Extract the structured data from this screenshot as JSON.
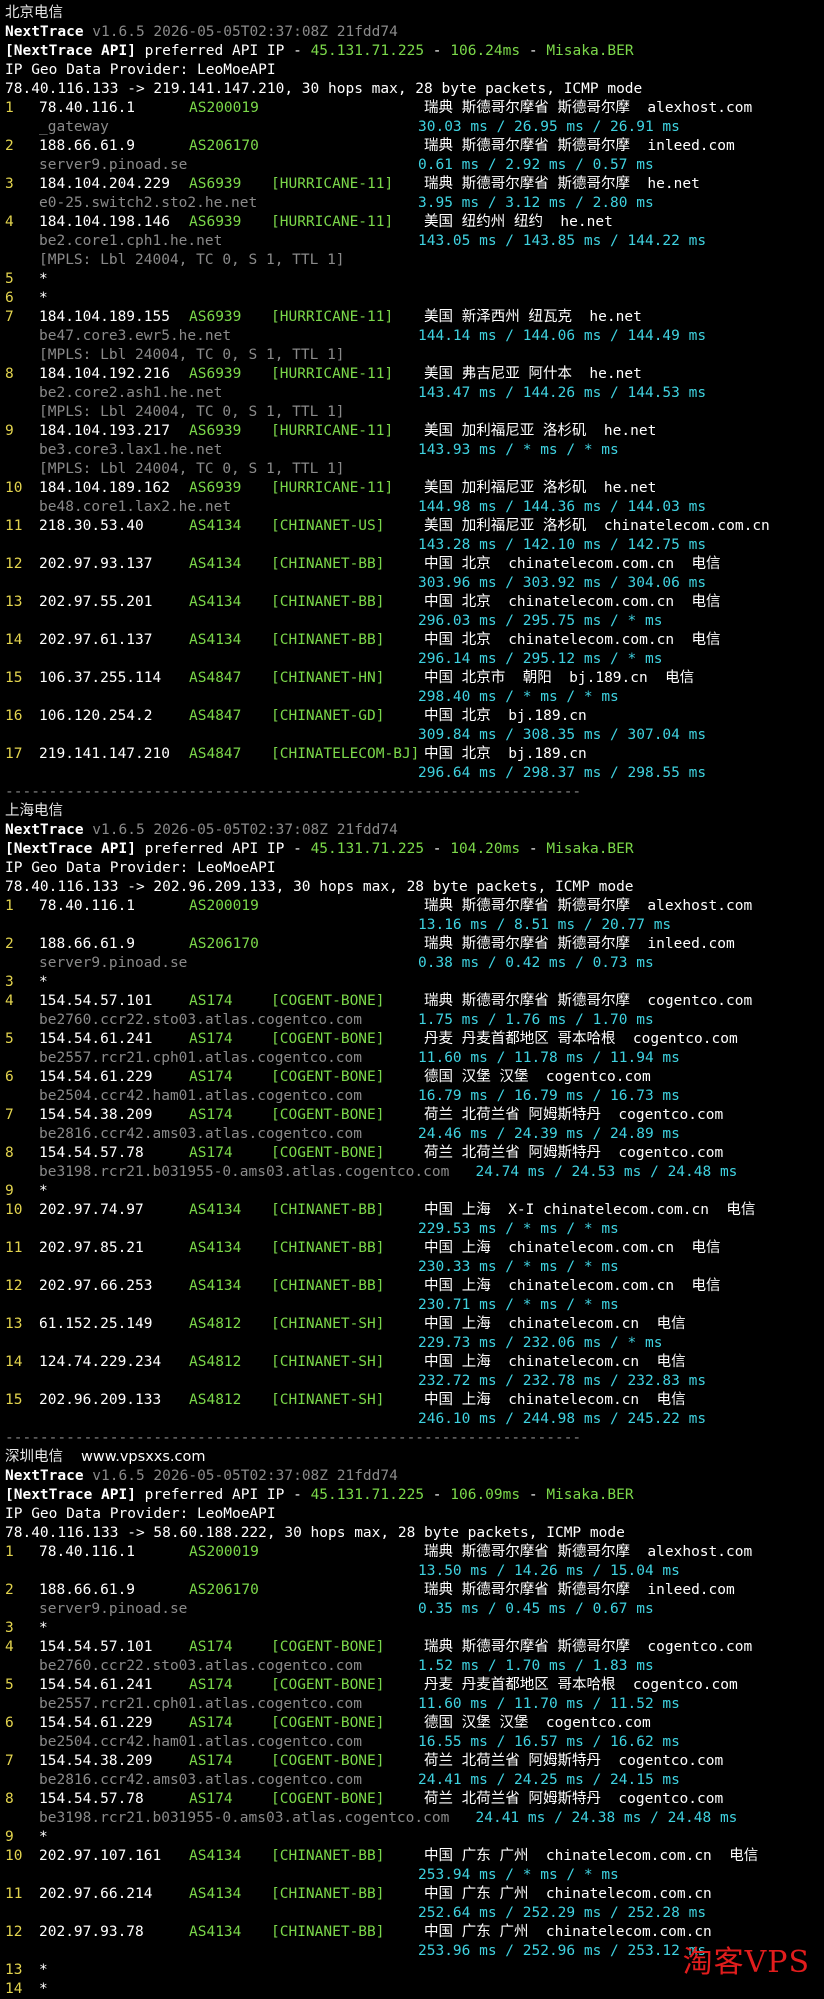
{
  "sections": [
    {
      "title": "北京电信",
      "site": "",
      "header": {
        "app_name": "NextTrace",
        "version": " v1.6.5 2026-05-05T02:37:08Z 21fdd74",
        "api_prefix": "[NextTrace API]",
        "api_text": " preferred API IP - ",
        "api_ip": "45.131.71.225",
        "api_ms": "106.24ms",
        "api_node": "Misaka.BER",
        "geo_provider": "IP Geo Data Provider: LeoMoeAPI",
        "trace_line": "78.40.116.133 -> 219.141.147.210, 30 hops max, 28 byte packets, ICMP mode"
      },
      "hops": [
        {
          "hop": "1",
          "ip": "78.40.116.1",
          "asn": "AS200019",
          "tag": "",
          "geo": "瑞典 斯德哥尔摩省 斯德哥尔摩  alexhost.com",
          "times": "30.03 ms / 26.95 ms / 26.91 ms",
          "host": "_gateway",
          "extra": ""
        },
        {
          "hop": "2",
          "ip": "188.66.61.9",
          "asn": "AS206170",
          "tag": "",
          "geo": "瑞典 斯德哥尔摩省 斯德哥尔摩  inleed.com",
          "times": "0.61 ms / 2.92 ms / 0.57 ms",
          "host": "server9.pinoad.se",
          "extra": ""
        },
        {
          "hop": "3",
          "ip": "184.104.204.229",
          "asn": "AS6939",
          "tag": "[HURRICANE-11]",
          "geo": "瑞典 斯德哥尔摩省 斯德哥尔摩  he.net",
          "times": "3.95 ms / 3.12 ms / 2.80 ms",
          "host": "e0-25.switch2.sto2.he.net",
          "extra": ""
        },
        {
          "hop": "4",
          "ip": "184.104.198.146",
          "asn": "AS6939",
          "tag": "[HURRICANE-11]",
          "geo": "美国 纽约州 纽约  he.net",
          "times": "143.05 ms / 143.85 ms / 144.22 ms",
          "host": "be2.core1.cph1.he.net",
          "extra": "[MPLS: Lbl 24004, TC 0, S 1, TTL 1]"
        },
        {
          "hop": "5",
          "ip": "*",
          "asn": "",
          "tag": "",
          "geo": "",
          "times": "",
          "host": "",
          "extra": ""
        },
        {
          "hop": "6",
          "ip": "*",
          "asn": "",
          "tag": "",
          "geo": "",
          "times": "",
          "host": "",
          "extra": ""
        },
        {
          "hop": "7",
          "ip": "184.104.189.155",
          "asn": "AS6939",
          "tag": "[HURRICANE-11]",
          "geo": "美国 新泽西州 纽瓦克  he.net",
          "times": "144.14 ms / 144.06 ms / 144.49 ms",
          "host": "be47.core3.ewr5.he.net",
          "extra": "[MPLS: Lbl 24004, TC 0, S 1, TTL 1]"
        },
        {
          "hop": "8",
          "ip": "184.104.192.216",
          "asn": "AS6939",
          "tag": "[HURRICANE-11]",
          "geo": "美国 弗吉尼亚 阿什本  he.net",
          "times": "143.47 ms / 144.26 ms / 144.53 ms",
          "host": "be2.core2.ash1.he.net",
          "extra": "[MPLS: Lbl 24004, TC 0, S 1, TTL 1]"
        },
        {
          "hop": "9",
          "ip": "184.104.193.217",
          "asn": "AS6939",
          "tag": "[HURRICANE-11]",
          "geo": "美国 加利福尼亚 洛杉矶  he.net",
          "times": "143.93 ms / * ms / * ms",
          "host": "be3.core3.lax1.he.net",
          "extra": "[MPLS: Lbl 24004, TC 0, S 1, TTL 1]"
        },
        {
          "hop": "10",
          "ip": "184.104.189.162",
          "asn": "AS6939",
          "tag": "[HURRICANE-11]",
          "geo": "美国 加利福尼亚 洛杉矶  he.net",
          "times": "144.98 ms / 144.36 ms / 144.03 ms",
          "host": "be48.core1.lax2.he.net",
          "extra": ""
        },
        {
          "hop": "11",
          "ip": "218.30.53.40",
          "asn": "AS4134",
          "tag": "[CHINANET-US]",
          "geo": "美国 加利福尼亚 洛杉矶  chinatelecom.com.cn",
          "times": "143.28 ms / 142.10 ms / 142.75 ms",
          "host": "",
          "extra": ""
        },
        {
          "hop": "12",
          "ip": "202.97.93.137",
          "asn": "AS4134",
          "tag": "[CHINANET-BB]",
          "geo": "中国 北京  chinatelecom.com.cn  电信",
          "times": "303.96 ms / 303.92 ms / 304.06 ms",
          "host": "",
          "extra": ""
        },
        {
          "hop": "13",
          "ip": "202.97.55.201",
          "asn": "AS4134",
          "tag": "[CHINANET-BB]",
          "geo": "中国 北京  chinatelecom.com.cn  电信",
          "times": "296.03 ms / 295.75 ms / * ms",
          "host": "",
          "extra": ""
        },
        {
          "hop": "14",
          "ip": "202.97.61.137",
          "asn": "AS4134",
          "tag": "[CHINANET-BB]",
          "geo": "中国 北京  chinatelecom.com.cn  电信",
          "times": "296.14 ms / 295.12 ms / * ms",
          "host": "",
          "extra": ""
        },
        {
          "hop": "15",
          "ip": "106.37.255.114",
          "asn": "AS4847",
          "tag": "[CHINANET-HN]",
          "geo": "中国 北京市  朝阳  bj.189.cn  电信",
          "times": "298.40 ms / * ms / * ms",
          "host": "",
          "extra": ""
        },
        {
          "hop": "16",
          "ip": "106.120.254.2",
          "asn": "AS4847",
          "tag": "[CHINANET-GD]",
          "geo": "中国 北京  bj.189.cn",
          "times": "309.84 ms / 308.35 ms / 307.04 ms",
          "host": "",
          "extra": ""
        },
        {
          "hop": "17",
          "ip": "219.141.147.210",
          "asn": "AS4847",
          "tag": "[CHINATELECOM-BJ]",
          "geo": "中国 北京  bj.189.cn",
          "times": "296.64 ms / 298.37 ms / 298.55 ms",
          "host": "",
          "extra": ""
        }
      ],
      "separator": "------------------------------------------------------------------"
    },
    {
      "title": "上海电信",
      "site": "",
      "header": {
        "app_name": "NextTrace",
        "version": " v1.6.5 2026-05-05T02:37:08Z 21fdd74",
        "api_prefix": "[NextTrace API]",
        "api_text": " preferred API IP - ",
        "api_ip": "45.131.71.225",
        "api_ms": "104.20ms",
        "api_node": "Misaka.BER",
        "geo_provider": "IP Geo Data Provider: LeoMoeAPI",
        "trace_line": "78.40.116.133 -> 202.96.209.133, 30 hops max, 28 byte packets, ICMP mode"
      },
      "hops": [
        {
          "hop": "1",
          "ip": "78.40.116.1",
          "asn": "AS200019",
          "tag": "",
          "geo": "瑞典 斯德哥尔摩省 斯德哥尔摩  alexhost.com",
          "times": "13.16 ms / 8.51 ms / 20.77 ms",
          "host": "",
          "extra": ""
        },
        {
          "hop": "2",
          "ip": "188.66.61.9",
          "asn": "AS206170",
          "tag": "",
          "geo": "瑞典 斯德哥尔摩省 斯德哥尔摩  inleed.com",
          "times": "0.38 ms / 0.42 ms / 0.73 ms",
          "host": "server9.pinoad.se",
          "extra": ""
        },
        {
          "hop": "3",
          "ip": "*",
          "asn": "",
          "tag": "",
          "geo": "",
          "times": "",
          "host": "",
          "extra": ""
        },
        {
          "hop": "4",
          "ip": "154.54.57.101",
          "asn": "AS174",
          "tag": "[COGENT-BONE]",
          "geo": "瑞典 斯德哥尔摩省 斯德哥尔摩  cogentco.com",
          "times": "1.75 ms / 1.76 ms / 1.70 ms",
          "host": "be2760.ccr22.sto03.atlas.cogentco.com",
          "extra": ""
        },
        {
          "hop": "5",
          "ip": "154.54.61.241",
          "asn": "AS174",
          "tag": "[COGENT-BONE]",
          "geo": "丹麦 丹麦首都地区 哥本哈根  cogentco.com",
          "times": "11.60 ms / 11.78 ms / 11.94 ms",
          "host": "be2557.rcr21.cph01.atlas.cogentco.com",
          "extra": ""
        },
        {
          "hop": "6",
          "ip": "154.54.61.229",
          "asn": "AS174",
          "tag": "[COGENT-BONE]",
          "geo": "德国 汉堡 汉堡  cogentco.com",
          "times": "16.79 ms / 16.79 ms / 16.73 ms",
          "host": "be2504.ccr42.ham01.atlas.cogentco.com",
          "extra": ""
        },
        {
          "hop": "7",
          "ip": "154.54.38.209",
          "asn": "AS174",
          "tag": "[COGENT-BONE]",
          "geo": "荷兰 北荷兰省 阿姆斯特丹  cogentco.com",
          "times": "24.46 ms / 24.39 ms / 24.89 ms",
          "host": "be2816.ccr42.ams03.atlas.cogentco.com",
          "extra": ""
        },
        {
          "hop": "8",
          "ip": "154.54.57.78",
          "asn": "AS174",
          "tag": "[COGENT-BONE]",
          "geo": "荷兰 北荷兰省 阿姆斯特丹  cogentco.com",
          "times": "",
          "host": "be3198.rcr21.b031955-0.ams03.atlas.cogentco.com",
          "host_times": "24.74 ms / 24.53 ms / 24.48 ms",
          "extra": ""
        },
        {
          "hop": "9",
          "ip": "*",
          "asn": "",
          "tag": "",
          "geo": "",
          "times": "",
          "host": "",
          "extra": ""
        },
        {
          "hop": "10",
          "ip": "202.97.74.97",
          "asn": "AS4134",
          "tag": "[CHINANET-BB]",
          "geo": "中国 上海  X-I chinatelecom.com.cn  电信",
          "times": "229.53 ms / * ms / * ms",
          "host": "",
          "extra": ""
        },
        {
          "hop": "11",
          "ip": "202.97.85.21",
          "asn": "AS4134",
          "tag": "[CHINANET-BB]",
          "geo": "中国 上海  chinatelecom.com.cn  电信",
          "times": "230.33 ms / * ms / * ms",
          "host": "",
          "extra": ""
        },
        {
          "hop": "12",
          "ip": "202.97.66.253",
          "asn": "AS4134",
          "tag": "[CHINANET-BB]",
          "geo": "中国 上海  chinatelecom.com.cn  电信",
          "times": "230.71 ms / * ms / * ms",
          "host": "",
          "extra": ""
        },
        {
          "hop": "13",
          "ip": "61.152.25.149",
          "asn": "AS4812",
          "tag": "[CHINANET-SH]",
          "geo": "中国 上海  chinatelecom.cn  电信",
          "times": "229.73 ms / 232.06 ms / * ms",
          "host": "",
          "extra": ""
        },
        {
          "hop": "14",
          "ip": "124.74.229.234",
          "asn": "AS4812",
          "tag": "[CHINANET-SH]",
          "geo": "中国 上海  chinatelecom.cn  电信",
          "times": "232.72 ms / 232.78 ms / 232.83 ms",
          "host": "",
          "extra": ""
        },
        {
          "hop": "15",
          "ip": "202.96.209.133",
          "asn": "AS4812",
          "tag": "[CHINANET-SH]",
          "geo": "中国 上海  chinatelecom.cn  电信",
          "times": "246.10 ms / 244.98 ms / 245.22 ms",
          "host": "",
          "extra": ""
        }
      ],
      "separator": "------------------------------------------------------------------"
    },
    {
      "title": "深圳电信",
      "site": "www.vpsxxs.com",
      "header": {
        "app_name": "NextTrace",
        "version": " v1.6.5 2026-05-05T02:37:08Z 21fdd74",
        "api_prefix": "[NextTrace API]",
        "api_text": " preferred API IP - ",
        "api_ip": "45.131.71.225",
        "api_ms": "106.09ms",
        "api_node": "Misaka.BER",
        "geo_provider": "IP Geo Data Provider: LeoMoeAPI",
        "trace_line": "78.40.116.133 -> 58.60.188.222, 30 hops max, 28 byte packets, ICMP mode"
      },
      "hops": [
        {
          "hop": "1",
          "ip": "78.40.116.1",
          "asn": "AS200019",
          "tag": "",
          "geo": "瑞典 斯德哥尔摩省 斯德哥尔摩  alexhost.com",
          "times": "13.50 ms / 14.26 ms / 15.04 ms",
          "host": "",
          "extra": ""
        },
        {
          "hop": "2",
          "ip": "188.66.61.9",
          "asn": "AS206170",
          "tag": "",
          "geo": "瑞典 斯德哥尔摩省 斯德哥尔摩  inleed.com",
          "times": "0.35 ms / 0.45 ms / 0.67 ms",
          "host": "server9.pinoad.se",
          "extra": ""
        },
        {
          "hop": "3",
          "ip": "*",
          "asn": "",
          "tag": "",
          "geo": "",
          "times": "",
          "host": "",
          "extra": ""
        },
        {
          "hop": "4",
          "ip": "154.54.57.101",
          "asn": "AS174",
          "tag": "[COGENT-BONE]",
          "geo": "瑞典 斯德哥尔摩省 斯德哥尔摩  cogentco.com",
          "times": "1.52 ms / 1.70 ms / 1.83 ms",
          "host": "be2760.ccr22.sto03.atlas.cogentco.com",
          "extra": ""
        },
        {
          "hop": "5",
          "ip": "154.54.61.241",
          "asn": "AS174",
          "tag": "[COGENT-BONE]",
          "geo": "丹麦 丹麦首都地区 哥本哈根  cogentco.com",
          "times": "11.60 ms / 11.70 ms / 11.52 ms",
          "host": "be2557.rcr21.cph01.atlas.cogentco.com",
          "extra": ""
        },
        {
          "hop": "6",
          "ip": "154.54.61.229",
          "asn": "AS174",
          "tag": "[COGENT-BONE]",
          "geo": "德国 汉堡 汉堡  cogentco.com",
          "times": "16.55 ms / 16.57 ms / 16.62 ms",
          "host": "be2504.ccr42.ham01.atlas.cogentco.com",
          "extra": ""
        },
        {
          "hop": "7",
          "ip": "154.54.38.209",
          "asn": "AS174",
          "tag": "[COGENT-BONE]",
          "geo": "荷兰 北荷兰省 阿姆斯特丹  cogentco.com",
          "times": "24.41 ms / 24.25 ms / 24.15 ms",
          "host": "be2816.ccr42.ams03.atlas.cogentco.com",
          "extra": ""
        },
        {
          "hop": "8",
          "ip": "154.54.57.78",
          "asn": "AS174",
          "tag": "[COGENT-BONE]",
          "geo": "荷兰 北荷兰省 阿姆斯特丹  cogentco.com",
          "times": "",
          "host": "be3198.rcr21.b031955-0.ams03.atlas.cogentco.com",
          "host_times": "24.41 ms / 24.38 ms / 24.48 ms",
          "extra": ""
        },
        {
          "hop": "9",
          "ip": "*",
          "asn": "",
          "tag": "",
          "geo": "",
          "times": "",
          "host": "",
          "extra": ""
        },
        {
          "hop": "10",
          "ip": "202.97.107.161",
          "asn": "AS4134",
          "tag": "[CHINANET-BB]",
          "geo": "中国 广东 广州  chinatelecom.com.cn  电信",
          "times": "253.94 ms / * ms / * ms",
          "host": "",
          "extra": ""
        },
        {
          "hop": "11",
          "ip": "202.97.66.214",
          "asn": "AS4134",
          "tag": "[CHINANET-BB]",
          "geo": "中国 广东 广州  chinatelecom.com.cn",
          "times": "252.64 ms / 252.29 ms / 252.28 ms",
          "host": "",
          "extra": ""
        },
        {
          "hop": "12",
          "ip": "202.97.93.78",
          "asn": "AS4134",
          "tag": "[CHINANET-BB]",
          "geo": "中国 广东 广州  chinatelecom.com.cn",
          "times": "253.96 ms / 252.96 ms / 253.12 ms",
          "host": "",
          "extra": ""
        },
        {
          "hop": "13",
          "ip": "*",
          "asn": "",
          "tag": "",
          "geo": "",
          "times": "",
          "host": "",
          "extra": ""
        },
        {
          "hop": "14",
          "ip": "*",
          "asn": "",
          "tag": "",
          "geo": "",
          "times": "",
          "host": "",
          "extra": ""
        }
      ],
      "separator": ""
    }
  ],
  "watermark": "淘客VPS"
}
